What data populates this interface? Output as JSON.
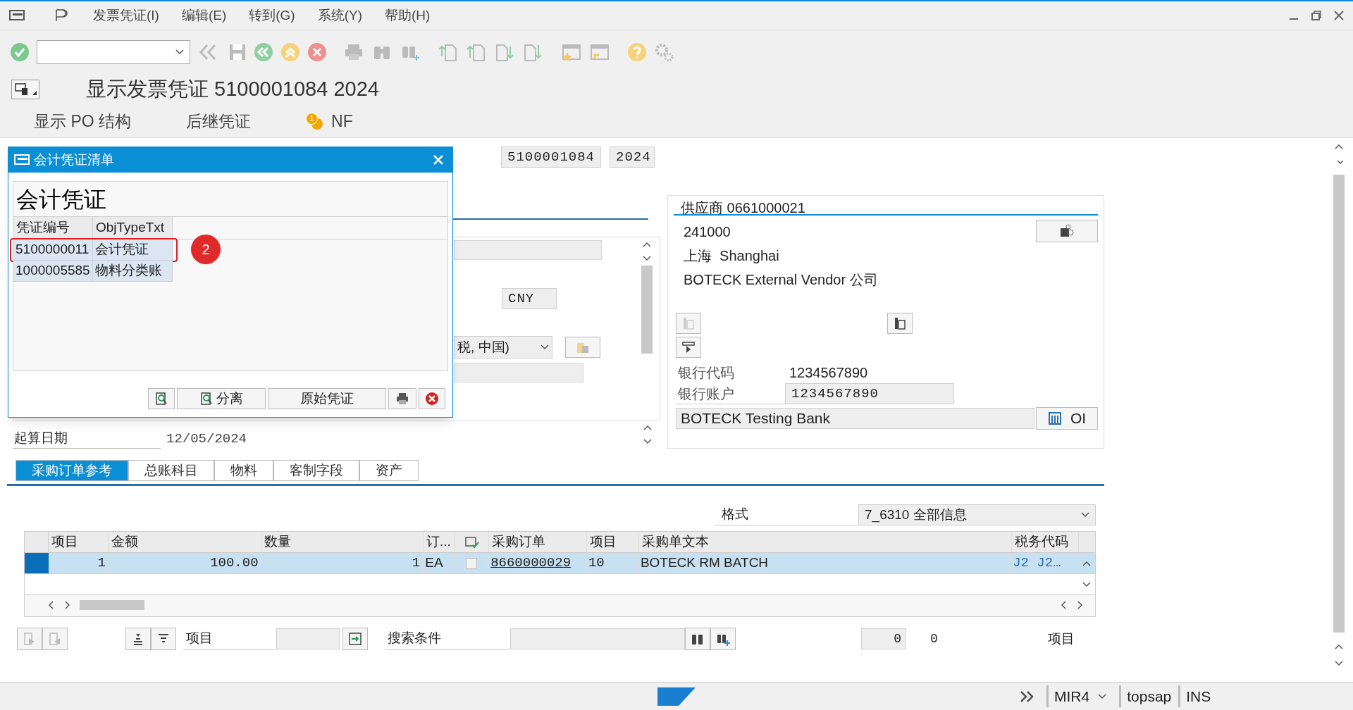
{
  "menu": [
    "发票凭证(I)",
    "编辑(E)",
    "转到(G)",
    "系统(Y)",
    "帮助(H)"
  ],
  "title": "显示发票凭证 5100001084 2024",
  "app_toolbar": [
    {
      "label": "显示 PO 结构",
      "kind": "text"
    },
    {
      "label": "后继凭证",
      "kind": "text"
    },
    {
      "label": "NF",
      "kind": "coin",
      "badge": "1"
    }
  ],
  "header_fields": [
    "5100001084",
    "2024"
  ],
  "dialog": {
    "title": "会计凭证清单",
    "heading": "会计凭证",
    "columns": [
      "凭证编号",
      "ObjTypeTxt"
    ],
    "rows": [
      {
        "cells": [
          "5100000011",
          "会计凭证"
        ],
        "annotated": true
      },
      {
        "cells": [
          "1000005585",
          "物料分类账"
        ],
        "annotated": false
      }
    ],
    "callout": "2",
    "buttons": [
      {
        "kind": "find"
      },
      {
        "kind": "find",
        "label": "分离"
      },
      {
        "kind": "text",
        "label": "原始凭证"
      },
      {
        "kind": "print"
      },
      {
        "kind": "cancel"
      }
    ]
  },
  "details": {
    "currency": "CNY",
    "tax_dropdown": "税, 中国)",
    "start_date_label": "起算日期",
    "start_date": "12/05/2024"
  },
  "vendor": {
    "heading": "供应商 0661000021",
    "lines": [
      "241000",
      "上海  Shanghai",
      "BOTECK External Vendor 公司"
    ],
    "bank_code_label": "银行代码",
    "bank_code": "1234567890",
    "bank_account_label": "银行账户",
    "bank_account": "1234567890",
    "bank_name": "BOTECK Testing Bank",
    "oi_button": "OI"
  },
  "tabs": [
    {
      "label": "采购订单参考",
      "selected": true
    },
    {
      "label": "总账科目",
      "selected": false
    },
    {
      "label": "物料",
      "selected": false
    },
    {
      "label": "客制字段",
      "selected": false
    },
    {
      "label": "资产",
      "selected": false
    }
  ],
  "format": {
    "label": "格式",
    "value": "7_6310 全部信息"
  },
  "table": {
    "columns": [
      {
        "label": "项目",
        "kind": "text"
      },
      {
        "label": "金额",
        "kind": "text"
      },
      {
        "label": "数量",
        "kind": "text"
      },
      {
        "label": "订...",
        "kind": "text"
      },
      {
        "kind": "icon"
      },
      {
        "label": "采购订单",
        "kind": "text"
      },
      {
        "label": "项目",
        "kind": "text"
      },
      {
        "label": "采购单文本",
        "kind": "text"
      },
      {
        "label": "税务代码",
        "kind": "text"
      }
    ],
    "rows": [
      {
        "item": "1",
        "amount": "100.00",
        "quantity": "1",
        "unit": "EA",
        "checked": false,
        "po": "8660000029",
        "po_item": "10",
        "text": "BOTECK RM BATCH",
        "tax_code": "J2  J2…",
        "selected": true
      }
    ]
  },
  "bottom": {
    "item_label": "项目",
    "search_label": "搜索条件",
    "count_field": "0",
    "count": "0",
    "item_label_right": "项目"
  },
  "status": {
    "transaction": "MIR4",
    "user": "topsap",
    "mode": "INS"
  }
}
